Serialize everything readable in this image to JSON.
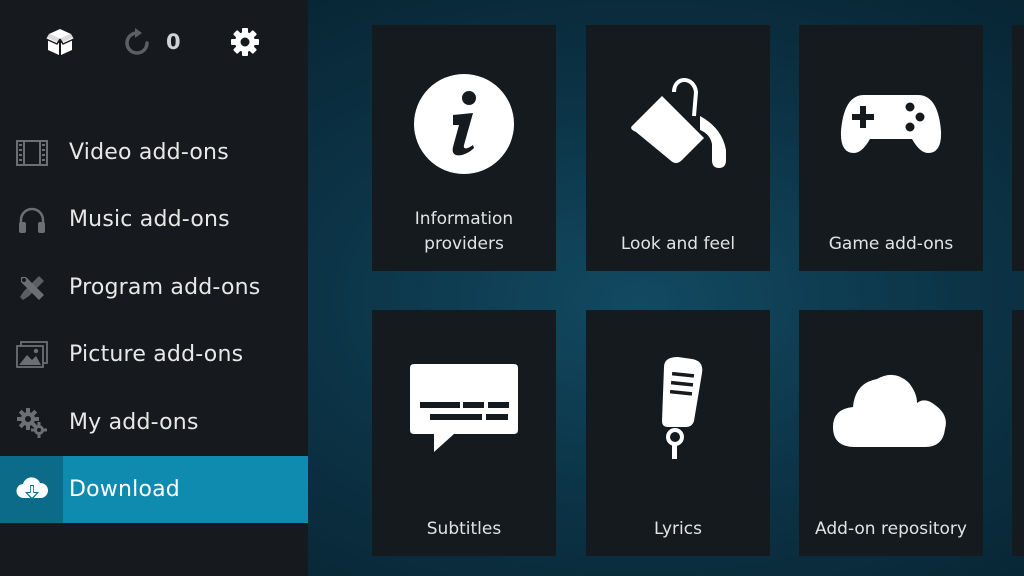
{
  "topbar": {
    "refresh_count": "0"
  },
  "sidebar": {
    "items": [
      {
        "label": "Video add-ons",
        "icon": "film-icon"
      },
      {
        "label": "Music add-ons",
        "icon": "headphones-icon"
      },
      {
        "label": "Program add-ons",
        "icon": "tools-icon"
      },
      {
        "label": "Picture add-ons",
        "icon": "pictures-icon"
      },
      {
        "label": "My add-ons",
        "icon": "gears-icon"
      },
      {
        "label": "Download",
        "icon": "cloud-download-icon",
        "active": true
      }
    ]
  },
  "tiles": [
    {
      "label": "Information providers",
      "icon": "info-icon"
    },
    {
      "label": "Look and feel",
      "icon": "paint-bucket-icon"
    },
    {
      "label": "Game add-ons",
      "icon": "gamepad-icon"
    },
    {
      "label": "Subtitles",
      "icon": "subtitles-icon"
    },
    {
      "label": "Lyrics",
      "icon": "microphone-icon"
    },
    {
      "label": "Add-on repository",
      "icon": "cloud-icon"
    }
  ],
  "colors": {
    "sidebar_bg": "#16191d",
    "active_item": "#108bb0",
    "active_icon_block": "#0d6b8a",
    "tile_bg": "#151a1e",
    "background": "#0c3447"
  }
}
